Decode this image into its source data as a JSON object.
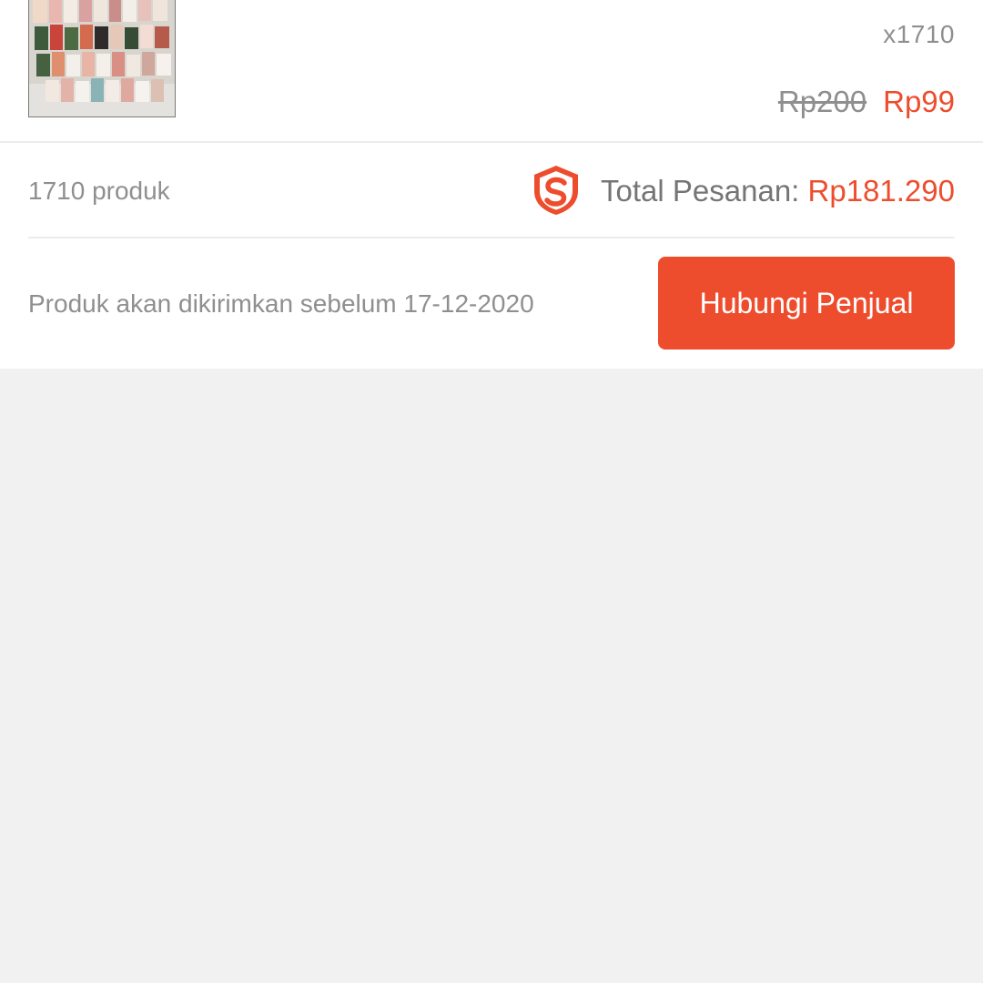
{
  "product": {
    "image_icon": "product-photo-cosmetics",
    "title": "",
    "quantity": "x1710",
    "original_price": "Rp200",
    "discount_price": "Rp99"
  },
  "summary": {
    "count_label": "1710 produk",
    "shield_icon": "shopee-guarantee-shield-icon",
    "total_label": "Total Pesanan:",
    "total_value": "Rp181.290"
  },
  "shipping": {
    "note": "Produk akan dikirimkan sebelum 17-12-2020",
    "contact_button": "Hubungi Penjual"
  },
  "colors": {
    "accent": "#ee4d2d",
    "muted_text": "#8f8f8f",
    "page_background": "#f1f1f1"
  }
}
